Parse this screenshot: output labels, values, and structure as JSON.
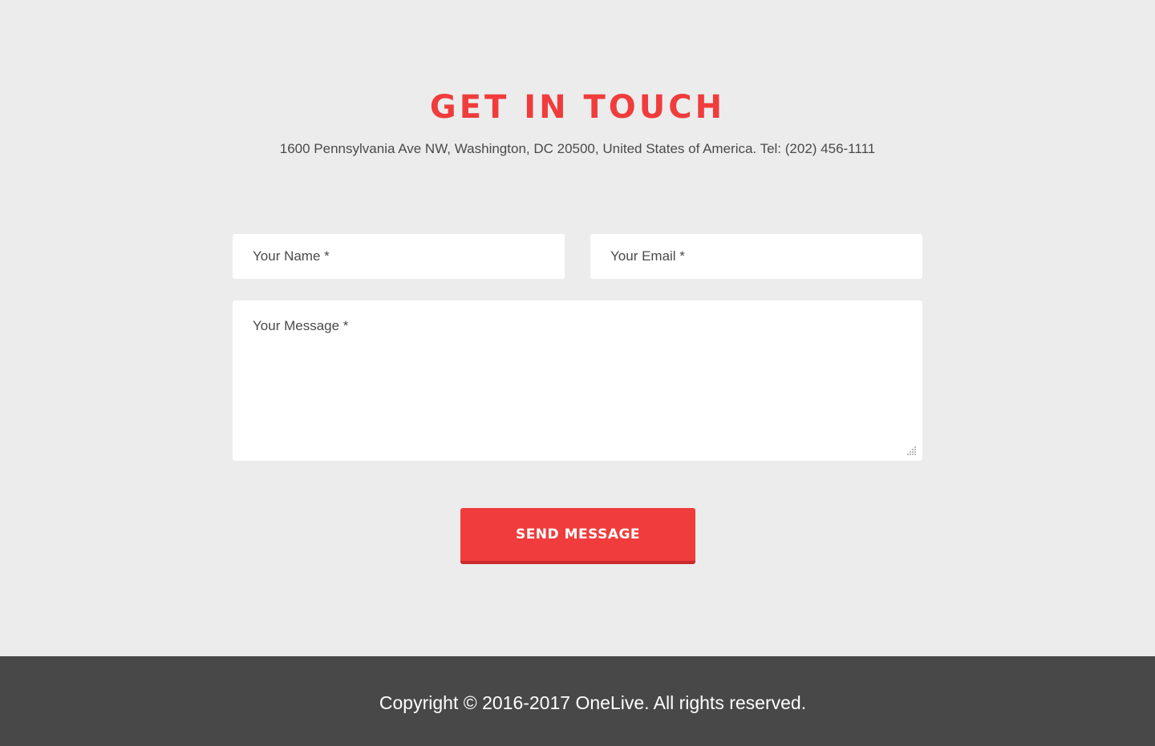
{
  "contact": {
    "title": "GET IN TOUCH",
    "address": "1600 Pennsylvania Ave NW, Washington, DC 20500, United States of America. Tel: (202) 456-1111"
  },
  "form": {
    "name_placeholder": "Your Name *",
    "email_placeholder": "Your Email *",
    "message_placeholder": "Your Message *",
    "send_label": "SEND MESSAGE"
  },
  "footer": {
    "copyright": "Copyright © 2016-2017 OneLive. All rights reserved."
  },
  "colors": {
    "accent": "#f03c3c",
    "background": "#ececec",
    "footer": "#484848",
    "text": "#4a4a4a"
  },
  "icons": {
    "resize": "resize-grip-icon"
  }
}
